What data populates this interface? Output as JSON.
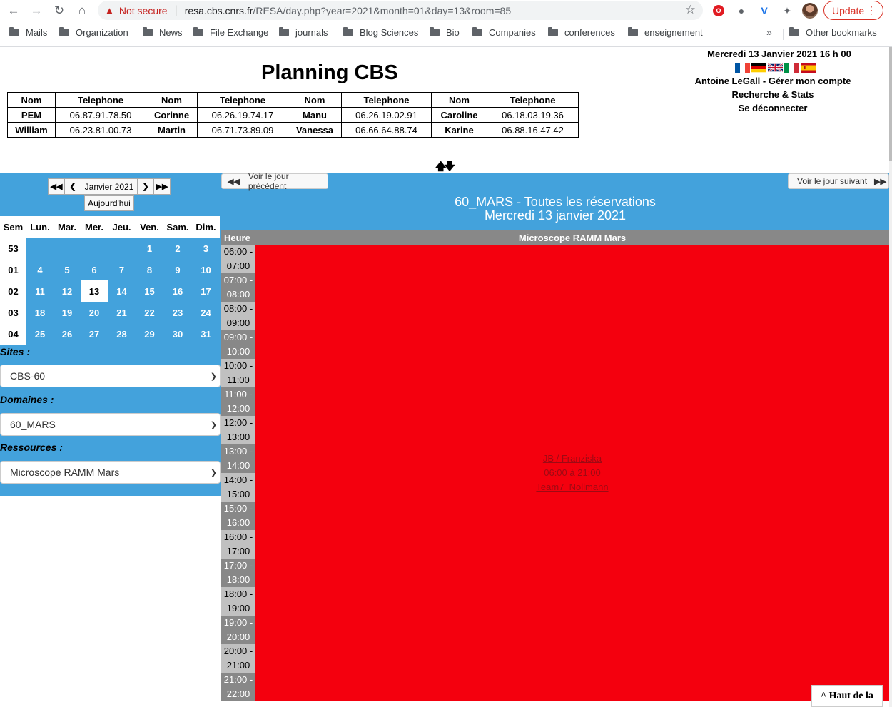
{
  "browser": {
    "not_secure": "Not secure",
    "url_host": "resa.cbs.cnrs.fr",
    "url_path": "/RESA/day.php?year=2021&month=01&day=13&room=85",
    "update_label": "Update",
    "bookmarks": [
      "Mails",
      "Organization",
      "News",
      "File Exchange",
      "journals",
      "Blog Sciences",
      "Bio",
      "Companies",
      "conferences",
      "enseignement"
    ],
    "more_bookmarks": "»",
    "other_bookmarks": "Other bookmarks"
  },
  "header": {
    "title": "Planning CBS",
    "datetime": "Mercredi 13 Janvier 2021  16 h 00",
    "account": "Antoine LeGall - Gérer mon compte",
    "search": "Recherche & Stats",
    "logout": "Se déconnecter",
    "flags": [
      "fr",
      "de",
      "gb",
      "it",
      "es"
    ]
  },
  "contacts": {
    "col_nom": "Nom",
    "col_tel": "Telephone",
    "rows": [
      [
        [
          "PEM",
          "06.87.91.78.50"
        ],
        [
          "Corinne",
          "06.26.19.74.17"
        ],
        [
          "Manu",
          "06.26.19.02.91"
        ],
        [
          "Caroline",
          "06.18.03.19.36"
        ]
      ],
      [
        [
          "William",
          "06.23.81.00.73"
        ],
        [
          "Martin",
          "06.71.73.89.09"
        ],
        [
          "Vanessa",
          "06.66.64.88.74"
        ],
        [
          "Karine",
          "06.88.16.47.42"
        ]
      ]
    ]
  },
  "calendar": {
    "month_label": "Janvier 2021",
    "today_label": "Aujourd'hui",
    "headers": [
      "Sem",
      "Lun.",
      "Mar.",
      "Mer.",
      "Jeu.",
      "Ven.",
      "Sam.",
      "Dim."
    ],
    "weeks": [
      {
        "num": "53",
        "days": [
          "",
          "",
          "",
          "",
          "1",
          "2",
          "3"
        ]
      },
      {
        "num": "01",
        "days": [
          "4",
          "5",
          "6",
          "7",
          "8",
          "9",
          "10"
        ]
      },
      {
        "num": "02",
        "days": [
          "11",
          "12",
          "13",
          "14",
          "15",
          "16",
          "17"
        ]
      },
      {
        "num": "03",
        "days": [
          "18",
          "19",
          "20",
          "21",
          "22",
          "23",
          "24"
        ]
      },
      {
        "num": "04",
        "days": [
          "25",
          "26",
          "27",
          "28",
          "29",
          "30",
          "31"
        ]
      }
    ],
    "selected_day": "13"
  },
  "filters": {
    "sites_label": "Sites :",
    "sites_value": "CBS-60",
    "domaines_label": "Domaines :",
    "domaines_value": "60_MARS",
    "ressources_label": "Ressources :",
    "ressources_value": "Microscope RAMM Mars"
  },
  "day_view": {
    "prev_label": "Voir le jour précédent",
    "next_label": "Voir le jour suivant",
    "room_title": "60_MARS - Toutes les réservations",
    "date_title": "Mercredi 13 janvier 2021",
    "col_hour": "Heure",
    "col_resource": "Microscope RAMM Mars",
    "slots": [
      [
        "06:00 -",
        "07:00"
      ],
      [
        "07:00 -",
        "08:00"
      ],
      [
        "08:00 -",
        "09:00"
      ],
      [
        "09:00 -",
        "10:00"
      ],
      [
        "10:00 -",
        "11:00"
      ],
      [
        "11:00 -",
        "12:00"
      ],
      [
        "12:00 -",
        "13:00"
      ],
      [
        "13:00 -",
        "14:00"
      ],
      [
        "14:00 -",
        "15:00"
      ],
      [
        "15:00 -",
        "16:00"
      ],
      [
        "16:00 -",
        "17:00"
      ],
      [
        "17:00 -",
        "18:00"
      ],
      [
        "18:00 -",
        "19:00"
      ],
      [
        "19:00 -",
        "20:00"
      ],
      [
        "20:00 -",
        "21:00"
      ],
      [
        "21:00 -",
        "22:00"
      ]
    ],
    "booking": {
      "line1": "JB / Franziska",
      "line2": "06:00 à 21:00",
      "line3": "Team7_Nollmann",
      "color": "#f4000e"
    }
  },
  "back_to_top": "^ Haut de la"
}
